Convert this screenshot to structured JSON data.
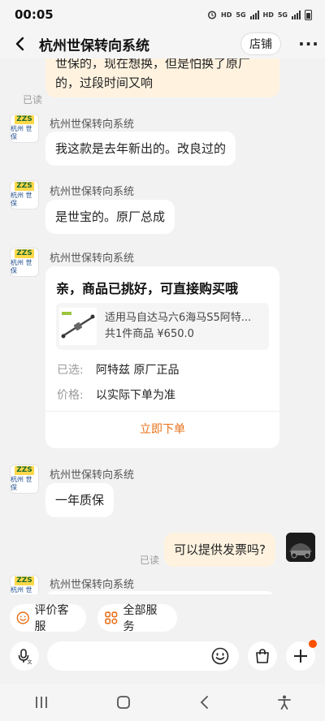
{
  "status_bar": {
    "time": "00:05",
    "hd1": "HD",
    "net1": "5G",
    "hd2": "HD",
    "net2": "5G"
  },
  "header": {
    "title": "杭州世保转向系统",
    "shop_label": "店铺"
  },
  "shop_avatar": {
    "top": "ZZS",
    "bottom": "杭州 世保"
  },
  "messages": [
    {
      "id": "m0",
      "from": "me",
      "text_line1": "世保的，现在想换，但是怕换了原厂",
      "text_line2": "的，过段时间又响",
      "read": "已读"
    },
    {
      "id": "m1",
      "from": "shop",
      "sender": "杭州世保转向系统",
      "text": "我这款是去年新出的。改良过的"
    },
    {
      "id": "m2",
      "from": "shop",
      "sender": "杭州世保转向系统",
      "text": "是世宝的。原厂总成"
    },
    {
      "id": "m3",
      "from": "shop",
      "sender": "杭州世保转向系统",
      "card": {
        "title": "亲，商品已挑好，可直接购买哦",
        "product_name": "适用马自达马六6海马S5阿特...",
        "product_meta": "共1件商品 ¥650.0",
        "selected_label": "已选:",
        "selected_value": "阿特兹 原厂正品",
        "price_label": "价格:",
        "price_value": "以实际下单为准",
        "buy_label": "立即下单"
      }
    },
    {
      "id": "m4",
      "from": "shop",
      "sender": "杭州世保转向系统",
      "text": "一年质保"
    },
    {
      "id": "m5",
      "from": "me",
      "text": "可以提供发票吗?",
      "read": "已读"
    },
    {
      "id": "m6",
      "from": "shop",
      "sender": "杭州世保转向系统"
    }
  ],
  "quick_actions": [
    {
      "label": "评价客服",
      "icon": "smile-icon"
    },
    {
      "label": "全部服务",
      "icon": "grid-icon"
    }
  ],
  "input_bar": {
    "placeholder": ""
  },
  "colors": {
    "accent": "#e8701a",
    "badge": "#ff5000",
    "peach_bubble": "#fff3e0"
  }
}
